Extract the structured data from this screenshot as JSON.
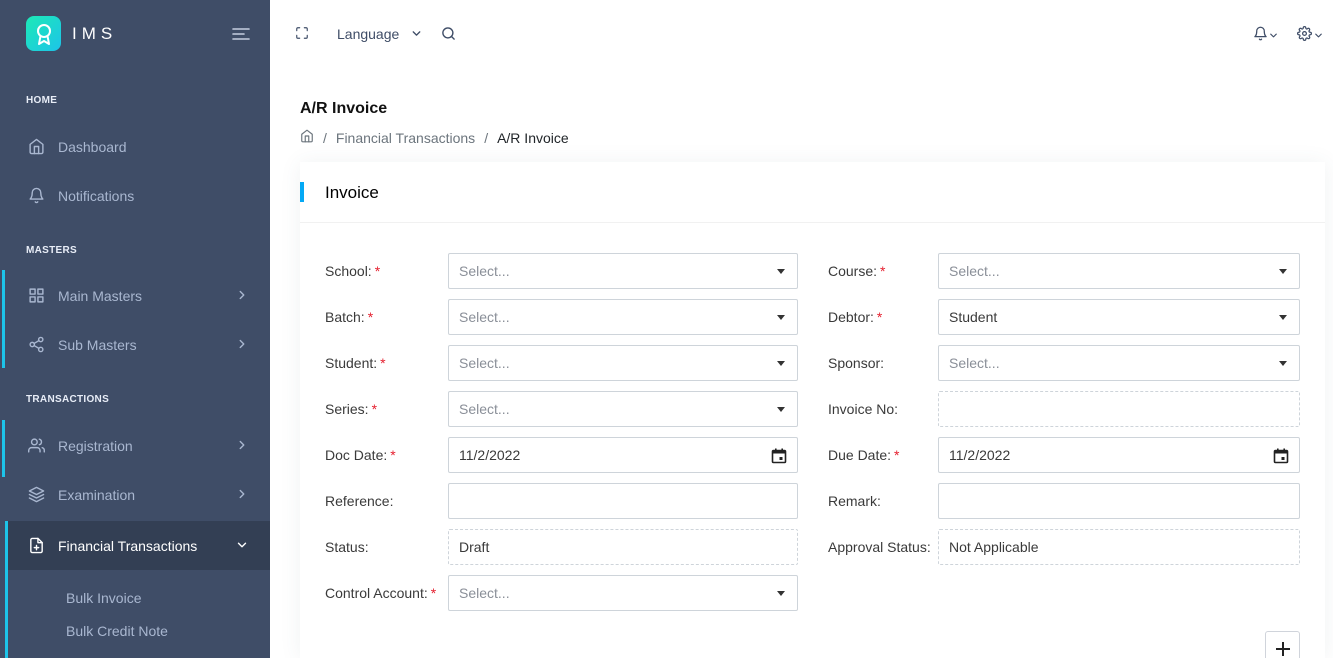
{
  "app": {
    "name": "IMS"
  },
  "sidebar": {
    "sections": [
      {
        "caption": "HOME"
      },
      {
        "caption": "MASTERS"
      },
      {
        "caption": "TRANSACTIONS"
      }
    ],
    "items": [
      {
        "label": "Dashboard",
        "icon": "home-icon"
      },
      {
        "label": "Notifications",
        "icon": "bell-icon"
      },
      {
        "label": "Main Masters",
        "icon": "grid-icon"
      },
      {
        "label": "Sub Masters",
        "icon": "share-icon"
      },
      {
        "label": "Registration",
        "icon": "users-icon"
      },
      {
        "label": "Examination",
        "icon": "layers-icon"
      },
      {
        "label": "Financial Transactions",
        "icon": "file-plus-icon"
      }
    ],
    "subitems": [
      {
        "label": "Bulk Invoice"
      },
      {
        "label": "Bulk Credit Note"
      }
    ]
  },
  "topbar": {
    "language_label": "Language"
  },
  "page": {
    "title": "A/R Invoice",
    "breadcrumb": [
      "Financial Transactions",
      "A/R Invoice"
    ]
  },
  "card": {
    "title": "Invoice"
  },
  "form": {
    "school": {
      "label": "School:",
      "value": "Select..."
    },
    "course": {
      "label": "Course:",
      "value": "Select..."
    },
    "batch": {
      "label": "Batch:",
      "value": "Select..."
    },
    "debtor": {
      "label": "Debtor:",
      "value": "Student"
    },
    "student": {
      "label": "Student:",
      "value": "Select..."
    },
    "sponsor": {
      "label": "Sponsor:",
      "value": "Select..."
    },
    "series": {
      "label": "Series:",
      "value": "Select..."
    },
    "invoice_no": {
      "label": "Invoice No:",
      "value": ""
    },
    "doc_date": {
      "label": "Doc Date:",
      "value": "11/2/2022"
    },
    "due_date": {
      "label": "Due Date:",
      "value": "11/2/2022"
    },
    "reference": {
      "label": "Reference:",
      "value": ""
    },
    "remark": {
      "label": "Remark:",
      "value": ""
    },
    "status": {
      "label": "Status:",
      "value": "Draft"
    },
    "approval_status": {
      "label": "Approval Status:",
      "value": "Not Applicable"
    },
    "control_account": {
      "label": "Control Account:",
      "value": "Select..."
    },
    "required_mark": "*"
  },
  "colors": {
    "sidebar_bg": "#3f4d67",
    "sidebar_active_bg": "#333f54",
    "accent": "#04a9f5",
    "brand_gradient": "#1de9b6",
    "required": "#e5202f"
  }
}
